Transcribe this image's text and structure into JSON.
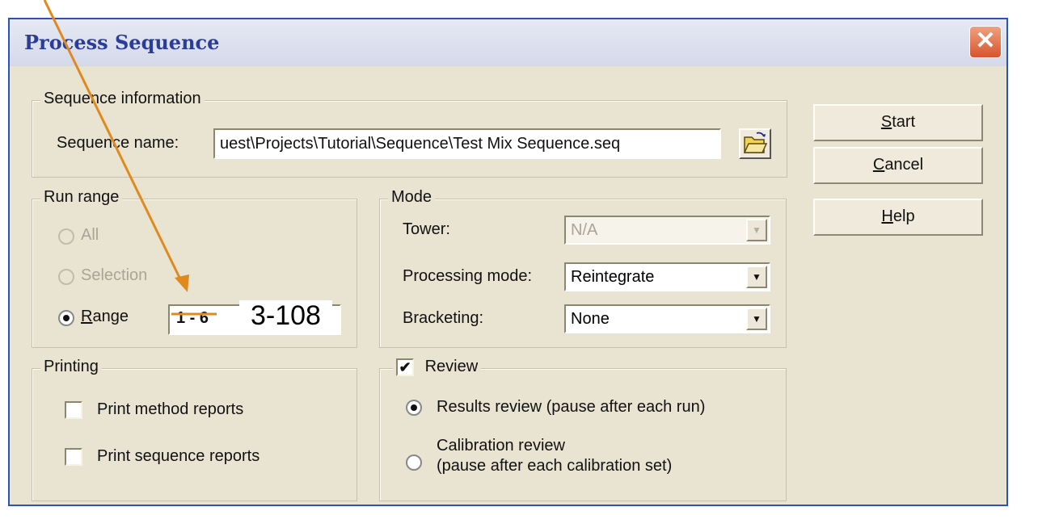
{
  "dialog": {
    "title": "Process Sequence",
    "close_glyph": "✕"
  },
  "sequence_info": {
    "legend": "Sequence information",
    "name_label": "Sequence name:",
    "name_value": "uest\\Projects\\Tutorial\\Sequence\\Test Mix Sequence.seq",
    "browse_icon": "folder-open-icon"
  },
  "run_range": {
    "legend": "Run range",
    "options": [
      {
        "label": "All",
        "selected": false,
        "enabled": false
      },
      {
        "label": "Selection",
        "selected": false,
        "enabled": false
      },
      {
        "label": "Range",
        "selected": true,
        "enabled": true
      }
    ],
    "range_value": "1 - 6"
  },
  "mode": {
    "legend": "Mode",
    "tower_label": "Tower:",
    "tower_value": "N/A",
    "processing_label": "Processing mode:",
    "processing_value": "Reintegrate",
    "bracketing_label": "Bracketing:",
    "bracketing_value": "None"
  },
  "printing": {
    "legend": "Printing",
    "options": [
      {
        "label": "Print method reports",
        "checked": false
      },
      {
        "label": "Print sequence reports",
        "checked": false
      }
    ]
  },
  "review": {
    "legend": "Review",
    "checked": true,
    "options": [
      {
        "label": "Results review (pause after each run)",
        "selected": true
      },
      {
        "label_line1": "Calibration review",
        "label_line2": "(pause after each calibration set)",
        "selected": false
      }
    ]
  },
  "buttons": {
    "start": "Start",
    "cancel": "Cancel",
    "help": "Help"
  },
  "annotation": {
    "range_overlay": "3-108",
    "arrow_color": "#e08a1e"
  }
}
